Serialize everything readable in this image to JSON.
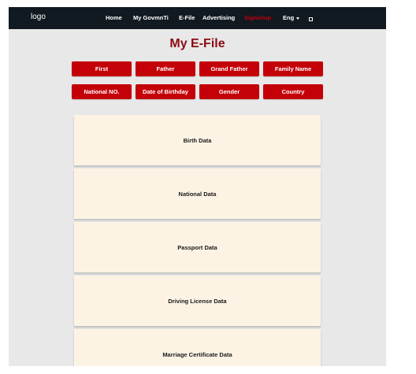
{
  "navbar": {
    "logo": "logo",
    "items": [
      "Home",
      "My GovmnTi",
      "E-File",
      "Advertising",
      "Signin/up"
    ],
    "language": "Eng"
  },
  "page": {
    "title": "My E-File"
  },
  "fields": {
    "row1": [
      "First",
      "Father",
      "Grand Father",
      "Family Name"
    ],
    "row2": [
      "National NO.",
      "Date of Birthday",
      "Gender",
      "Country"
    ]
  },
  "sections": [
    "Birth Data",
    "National Data",
    "Passport Data",
    "Driving License Data",
    "Marriage Certificate Data"
  ],
  "colors": {
    "navbar_bg": "#111a20",
    "accent_red": "#c40008",
    "title_red": "#8b0a12",
    "card_bg": "#fcf3e4",
    "page_bg": "#e8e8e8"
  }
}
